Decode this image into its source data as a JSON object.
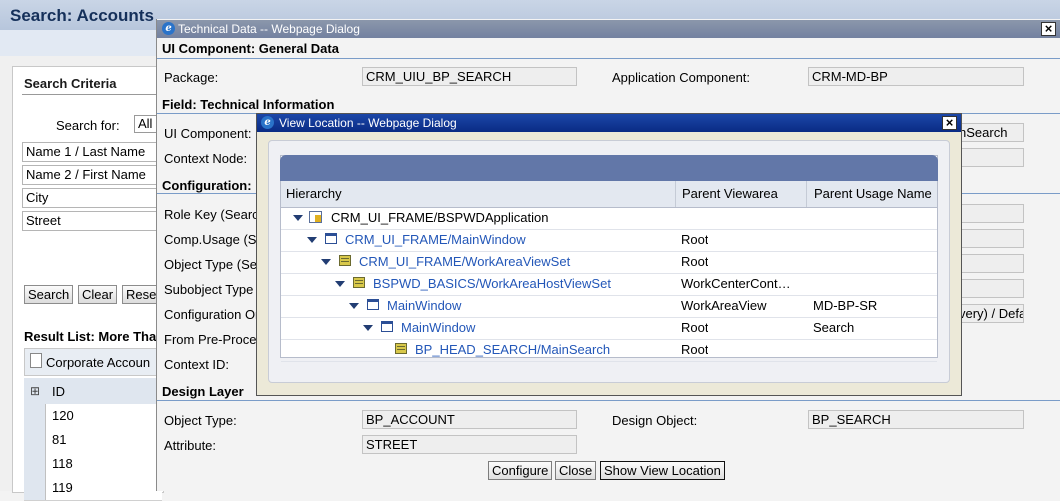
{
  "background": {
    "title": "Search: Accounts",
    "search_criteria": {
      "title": "Search Criteria",
      "search_for_label": "Search for:",
      "search_for_value": "All",
      "fields": [
        "Name 1 / Last Name",
        "Name 2 / First Name",
        "City",
        "Street"
      ],
      "buttons": [
        "Search",
        "Clear",
        "Rese"
      ]
    },
    "result_list": {
      "title": "Result List: More Tha",
      "new_button": "Corporate Accoun",
      "id_column": "ID",
      "ids": [
        "120",
        "81",
        "118",
        "119"
      ]
    }
  },
  "tech_dialog": {
    "title": "Technical Data -- Webpage Dialog",
    "sections": {
      "general": "UI Component: General Data",
      "field": "Field: Technical Information",
      "configuration": "Configuration:",
      "design": "Design Layer"
    },
    "general": {
      "package_label": "Package:",
      "package_value": "CRM_UIU_BP_SEARCH",
      "app_component_label": "Application Component:",
      "app_component_value": "CRM-MD-BP"
    },
    "field": {
      "ui_component_label": "UI Component:",
      "ui_component_value_tail": "nSearch",
      "context_node_label": "Context Node:"
    },
    "configuration": {
      "labels": [
        "Role Key (Searc",
        "Comp.Usage (S",
        "Object Type (Se",
        "Subobject Type",
        "Configuration Or",
        "From Pre-Proce",
        "Context ID:"
      ],
      "config_origin_tail": "very) / Defa"
    },
    "design": {
      "object_type_label": "Object Type:",
      "object_type_value": "BP_ACCOUNT",
      "design_object_label": "Design Object:",
      "design_object_value": "BP_SEARCH",
      "attribute_label": "Attribute:",
      "attribute_value": "STREET"
    },
    "buttons": {
      "configure": "Configure",
      "close": "Close",
      "show_view_location": "Show View Location"
    }
  },
  "view_location": {
    "title": "View Location -- Webpage Dialog",
    "columns": [
      "Hierarchy",
      "Parent Viewarea",
      "Parent Usage Name"
    ],
    "rows": [
      {
        "name": "CRM_UI_FRAME/BSPWDApplication",
        "viewarea": "",
        "usage": "",
        "icon": "application-icon",
        "link": false
      },
      {
        "name": "CRM_UI_FRAME/MainWindow",
        "viewarea": "Root",
        "usage": "",
        "icon": "window-icon",
        "link": true
      },
      {
        "name": "CRM_UI_FRAME/WorkAreaViewSet",
        "viewarea": "Root",
        "usage": "",
        "icon": "viewset-icon",
        "link": true
      },
      {
        "name": "BSPWD_BASICS/WorkAreaHostViewSet",
        "viewarea": "WorkCenterCont…",
        "usage": "",
        "icon": "viewset-icon",
        "link": true
      },
      {
        "name": "MainWindow",
        "viewarea": "WorkAreaView",
        "usage": "MD-BP-SR",
        "icon": "window-icon",
        "link": true
      },
      {
        "name": "MainWindow",
        "viewarea": "Root",
        "usage": "Search",
        "icon": "window-icon",
        "link": true
      },
      {
        "name": "BP_HEAD_SEARCH/MainSearch",
        "viewarea": "Root",
        "usage": "",
        "icon": "view-icon",
        "link": true
      }
    ]
  },
  "colors": {
    "link": "#2357b8",
    "view_location_titlebar": "#0a2b84",
    "tech_titlebar": "#7381a0",
    "table_header_band": "#6277a8"
  }
}
